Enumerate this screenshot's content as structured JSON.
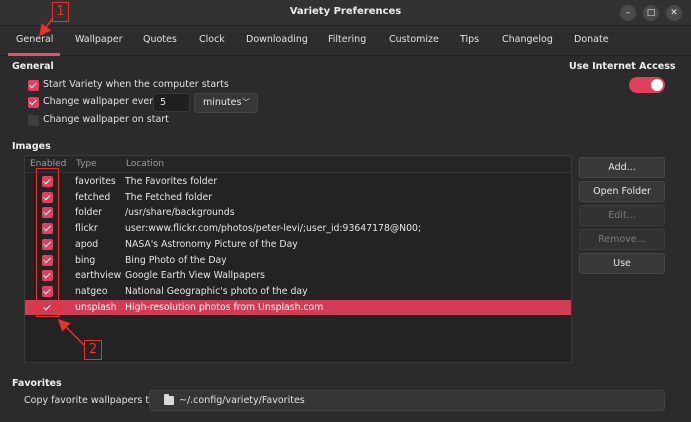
{
  "window": {
    "title": "Variety Preferences",
    "minimize": "–",
    "maximize": "□",
    "close": "✕"
  },
  "tabs": [
    "General",
    "Wallpaper",
    "Quotes",
    "Clock",
    "Downloading",
    "Filtering",
    "Customize",
    "Tips",
    "Changelog",
    "Donate"
  ],
  "general": {
    "heading": "General",
    "start_label": "Start Variety when the computer starts",
    "start_checked": true,
    "change_label": "Change wallpaper every",
    "change_checked": true,
    "interval_value": "5",
    "interval_unit": "minutes",
    "change_on_start_label": "Change wallpaper on start",
    "change_on_start_checked": false,
    "internet_label": "Use Internet Access",
    "internet_on": true
  },
  "images": {
    "heading": "Images",
    "columns": [
      "Enabled",
      "Type",
      "Location"
    ],
    "rows": [
      {
        "enabled": true,
        "type": "favorites",
        "location": "The Favorites folder"
      },
      {
        "enabled": true,
        "type": "fetched",
        "location": "The Fetched folder"
      },
      {
        "enabled": true,
        "type": "folder",
        "location": "/usr/share/backgrounds"
      },
      {
        "enabled": true,
        "type": "flickr",
        "location": "user:www.flickr.com/photos/peter-levi/;user_id:93647178@N00;"
      },
      {
        "enabled": true,
        "type": "apod",
        "location": "NASA's Astronomy Picture of the Day"
      },
      {
        "enabled": true,
        "type": "bing",
        "location": "Bing Photo of the Day"
      },
      {
        "enabled": true,
        "type": "earthview",
        "location": "Google Earth View Wallpapers"
      },
      {
        "enabled": true,
        "type": "natgeo",
        "location": "National Geographic's photo of the day"
      },
      {
        "enabled": true,
        "type": "unsplash",
        "location": "High-resolution photos from Unsplash.com",
        "selected": true
      }
    ],
    "buttons": {
      "add": "Add...",
      "open_folder": "Open Folder",
      "edit": "Edit...",
      "remove": "Remove...",
      "use": "Use"
    }
  },
  "favorites": {
    "heading": "Favorites",
    "copy_label": "Copy favorite wallpapers to",
    "path": "~/.config/variety/Favorites"
  },
  "annotations": [
    "1",
    "2"
  ],
  "colors": {
    "accent": "#e0405d",
    "selection": "#d13b54",
    "annotation": "#e8302c"
  }
}
